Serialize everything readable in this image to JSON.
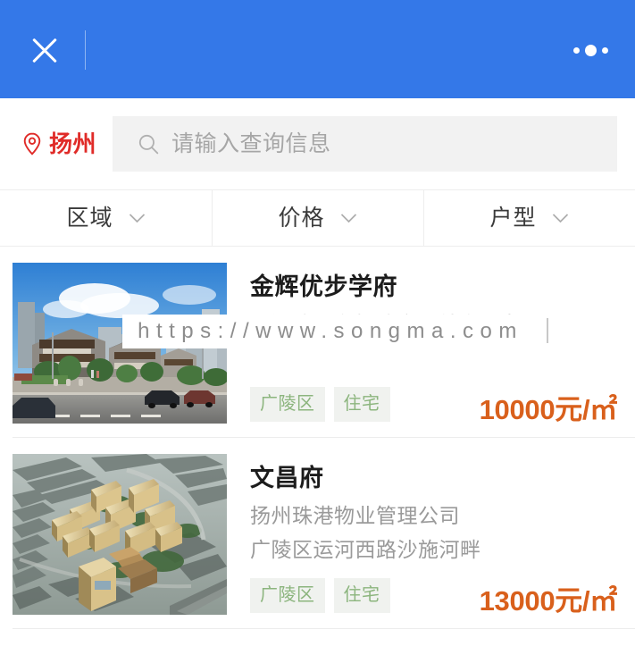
{
  "header": {
    "close_icon": "close-icon",
    "more_icon": "more-options-icon"
  },
  "search": {
    "pin_icon": "location-pin-icon",
    "city": "扬州",
    "search_icon": "search-icon",
    "placeholder": "请输入查询信息",
    "value": ""
  },
  "filters": [
    {
      "label": "区域",
      "icon": "chevron-down-icon"
    },
    {
      "label": "价格",
      "icon": "chevron-down-icon"
    },
    {
      "label": "户型",
      "icon": "chevron-down-icon"
    }
  ],
  "watermark": {
    "text": "https://www.songma.com"
  },
  "listings": [
    {
      "title": "金辉优步学府",
      "line1": "",
      "address": "西湖路与台扬路交汇处东北角",
      "tags": [
        "广陵区",
        "住宅"
      ],
      "price": "10000元/㎡",
      "thumb_alt": "street-view-rendering"
    },
    {
      "title": "文昌府",
      "line1": "扬州珠港物业管理公司",
      "address": "广陵区运河西路沙施河畔",
      "tags": [
        "广陵区",
        "住宅"
      ],
      "price": "13000元/㎡",
      "thumb_alt": "aerial-view-rendering"
    }
  ],
  "colors": {
    "header_blue": "#3478e8",
    "city_red": "#e02b28",
    "price_orange": "#d9601c",
    "tag_green": "#8cb57e",
    "tag_bg": "#f0f2ef"
  }
}
